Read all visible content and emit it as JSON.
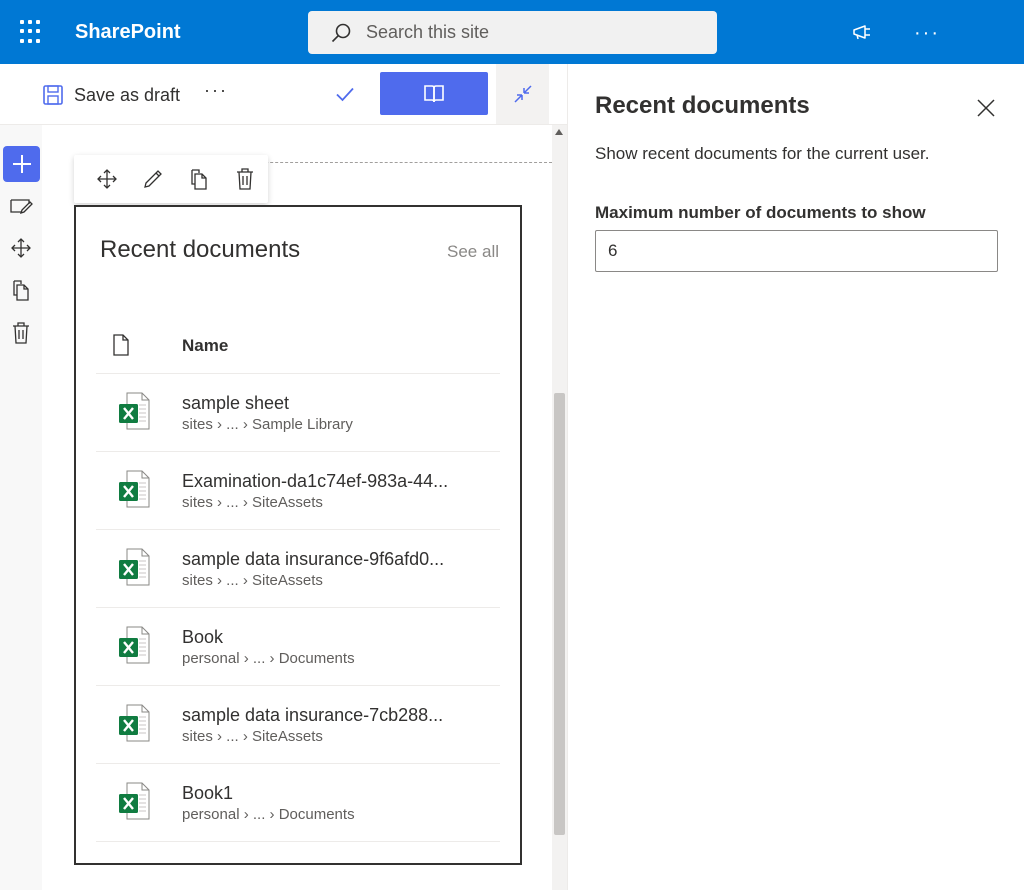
{
  "suite": {
    "app_name": "SharePoint",
    "search_placeholder": "Search this site"
  },
  "commandbar": {
    "save_draft_label": "Save as draft",
    "more_label": "···"
  },
  "webpart": {
    "title": "Recent documents",
    "see_all": "See all",
    "column_name": "Name",
    "documents": [
      {
        "name": "sample sheet",
        "path": "sites › ... › Sample Library"
      },
      {
        "name": "Examination-da1c74ef-983a-44...",
        "path": "sites › ... › SiteAssets"
      },
      {
        "name": "sample data insurance-9f6afd0...",
        "path": "sites › ... › SiteAssets"
      },
      {
        "name": "Book",
        "path": "personal › ... › Documents"
      },
      {
        "name": "sample data insurance-7cb288...",
        "path": "sites › ... › SiteAssets"
      },
      {
        "name": "Book1",
        "path": "personal › ... › Documents"
      }
    ]
  },
  "property_pane": {
    "title": "Recent documents",
    "description": "Show recent documents for the current user.",
    "field_label": "Maximum number of documents to show",
    "field_value": "6"
  },
  "colors": {
    "suite_blue": "#0078d4",
    "accent": "#4f6bed",
    "excel_green": "#107c41"
  }
}
